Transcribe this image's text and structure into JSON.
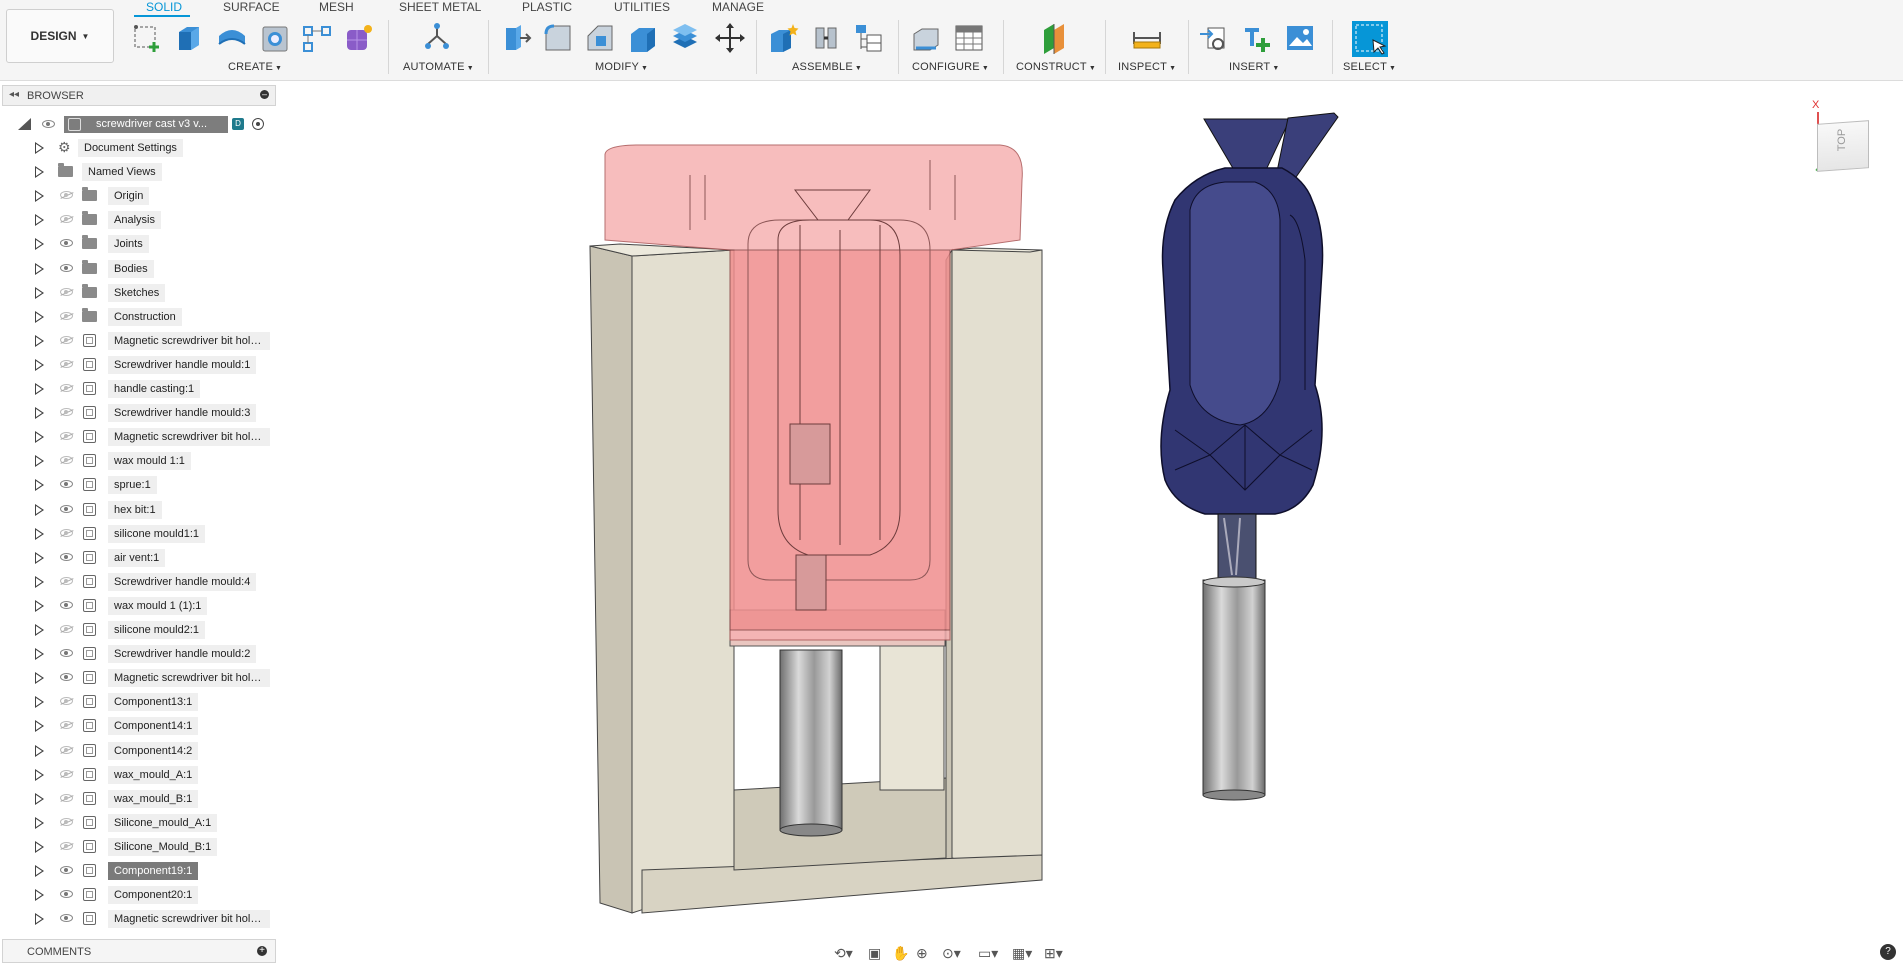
{
  "app": {
    "workspace": "DESIGN",
    "tabs": [
      "SOLID",
      "SURFACE",
      "MESH",
      "SHEET METAL",
      "PLASTIC",
      "UTILITIES",
      "MANAGE"
    ],
    "active_tab": "SOLID",
    "accent_color": "#0696d7"
  },
  "toolbar": {
    "groups": [
      "CREATE",
      "AUTOMATE",
      "MODIFY",
      "ASSEMBLE",
      "CONFIGURE",
      "CONSTRUCT",
      "INSPECT",
      "INSERT",
      "SELECT"
    ]
  },
  "browser": {
    "title": "BROWSER",
    "root": "screwdriver cast v3 v...",
    "items": [
      {
        "label": "Document Settings",
        "icon": "gear-icon",
        "visible": null
      },
      {
        "label": "Named Views",
        "icon": "folder-icon",
        "visible": null
      },
      {
        "label": "Origin",
        "icon": "folder-icon",
        "visible": false
      },
      {
        "label": "Analysis",
        "icon": "folder-icon",
        "visible": false
      },
      {
        "label": "Joints",
        "icon": "folder-icon",
        "visible": true
      },
      {
        "label": "Bodies",
        "icon": "folder-icon",
        "visible": true
      },
      {
        "label": "Sketches",
        "icon": "folder-icon",
        "visible": false
      },
      {
        "label": "Construction",
        "icon": "folder-icon",
        "visible": false
      },
      {
        "label": "Magnetic screwdriver bit hold...",
        "icon": "component-icon",
        "visible": false
      },
      {
        "label": "Screwdriver handle mould:1",
        "icon": "component-icon",
        "visible": false
      },
      {
        "label": "handle casting:1",
        "icon": "component-icon",
        "visible": false
      },
      {
        "label": "Screwdriver handle mould:3",
        "icon": "component-icon",
        "visible": false
      },
      {
        "label": "Magnetic screwdriver bit hold...",
        "icon": "component-icon",
        "visible": false
      },
      {
        "label": "wax mould 1:1",
        "icon": "component-icon",
        "visible": false
      },
      {
        "label": "sprue:1",
        "icon": "component-icon",
        "visible": true
      },
      {
        "label": "hex bit:1",
        "icon": "component-icon",
        "visible": true
      },
      {
        "label": "silicone mould1:1",
        "icon": "component-icon",
        "visible": false
      },
      {
        "label": "air vent:1",
        "icon": "component-icon",
        "visible": true
      },
      {
        "label": "Screwdriver handle mould:4",
        "icon": "component-icon",
        "visible": false
      },
      {
        "label": "wax mould 1 (1):1",
        "icon": "component-icon",
        "visible": true
      },
      {
        "label": "silicone mould2:1",
        "icon": "component-icon",
        "visible": false
      },
      {
        "label": "Screwdriver handle mould:2",
        "icon": "component-icon",
        "visible": true
      },
      {
        "label": "Magnetic screwdriver bit hold...",
        "icon": "component-icon",
        "visible": true
      },
      {
        "label": "Component13:1",
        "icon": "component-icon",
        "visible": false
      },
      {
        "label": "Component14:1",
        "icon": "component-icon",
        "visible": false
      },
      {
        "label": "Component14:2",
        "icon": "component-icon",
        "visible": false
      },
      {
        "label": "wax_mould_A:1",
        "icon": "component-icon",
        "visible": false
      },
      {
        "label": "wax_mould_B:1",
        "icon": "component-icon",
        "visible": false
      },
      {
        "label": "Silicone_mould_A:1",
        "icon": "component-icon",
        "visible": false
      },
      {
        "label": "Silicone_Mould_B:1",
        "icon": "component-icon",
        "visible": false
      },
      {
        "label": "Component19:1",
        "icon": "component-icon",
        "visible": true,
        "selected": true
      },
      {
        "label": "Component20:1",
        "icon": "component-icon",
        "visible": true
      },
      {
        "label": "Magnetic screwdriver bit hold...",
        "icon": "component-icon",
        "visible": true
      }
    ]
  },
  "comments": {
    "title": "COMMENTS"
  },
  "viewcube": {
    "face": "TOP",
    "axis_x": "X"
  }
}
